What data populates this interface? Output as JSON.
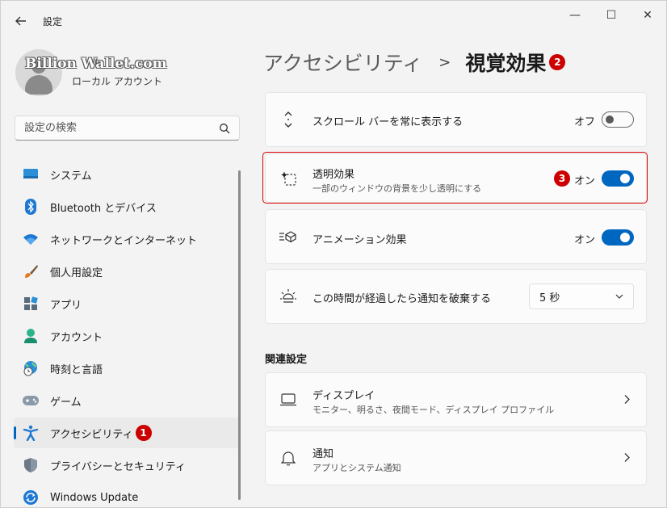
{
  "titlebar": {
    "title": "設定",
    "back_icon": "back-arrow-icon",
    "minimize": "—",
    "maximize": "☐",
    "close": "✕"
  },
  "user": {
    "name": "Billion Wallet.com",
    "account_type": "ローカル アカウント"
  },
  "search": {
    "placeholder": "設定の検索",
    "value": ""
  },
  "sidebar": {
    "items": [
      {
        "label": "システム",
        "icon": "system-icon"
      },
      {
        "label": "Bluetooth とデバイス",
        "icon": "bluetooth-icon"
      },
      {
        "label": "ネットワークとインターネット",
        "icon": "wifi-icon"
      },
      {
        "label": "個人用設定",
        "icon": "brush-icon"
      },
      {
        "label": "アプリ",
        "icon": "apps-icon"
      },
      {
        "label": "アカウント",
        "icon": "account-icon"
      },
      {
        "label": "時刻と言語",
        "icon": "globe-clock-icon"
      },
      {
        "label": "ゲーム",
        "icon": "gamepad-icon"
      },
      {
        "label": "アクセシビリティ",
        "icon": "accessibility-icon",
        "active": true,
        "badge": "1"
      },
      {
        "label": "プライバシーとセキュリティ",
        "icon": "shield-icon"
      },
      {
        "label": "Windows Update",
        "icon": "update-icon"
      }
    ]
  },
  "breadcrumb": {
    "parent": "アクセシビリティ",
    "separator": ">",
    "current": "視覚効果",
    "badge": "2"
  },
  "settings": [
    {
      "title": "スクロール バーを常に表示する",
      "state": "オフ",
      "on": false,
      "icon": "scroll-arrows-icon"
    },
    {
      "title": "透明効果",
      "subtitle": "一部のウィンドウの背景を少し透明にする",
      "state": "オン",
      "on": true,
      "icon": "sparkle-icon",
      "badge": "3"
    },
    {
      "title": "アニメーション効果",
      "state": "オン",
      "on": true,
      "icon": "animation-icon"
    },
    {
      "title": "この時間が経過したら通知を破棄する",
      "dropdown_value": "5 秒",
      "icon": "brightness-icon"
    }
  ],
  "related": {
    "heading": "関連設定",
    "items": [
      {
        "title": "ディスプレイ",
        "subtitle": "モニター、明るさ、夜間モード、ディスプレイ プロファイル",
        "icon": "display-icon"
      },
      {
        "title": "通知",
        "subtitle": "アプリとシステム通知",
        "icon": "bell-icon"
      }
    ]
  },
  "colors": {
    "accent": "#0067c0",
    "badge": "#cc0000",
    "highlight": "#dd0000"
  }
}
